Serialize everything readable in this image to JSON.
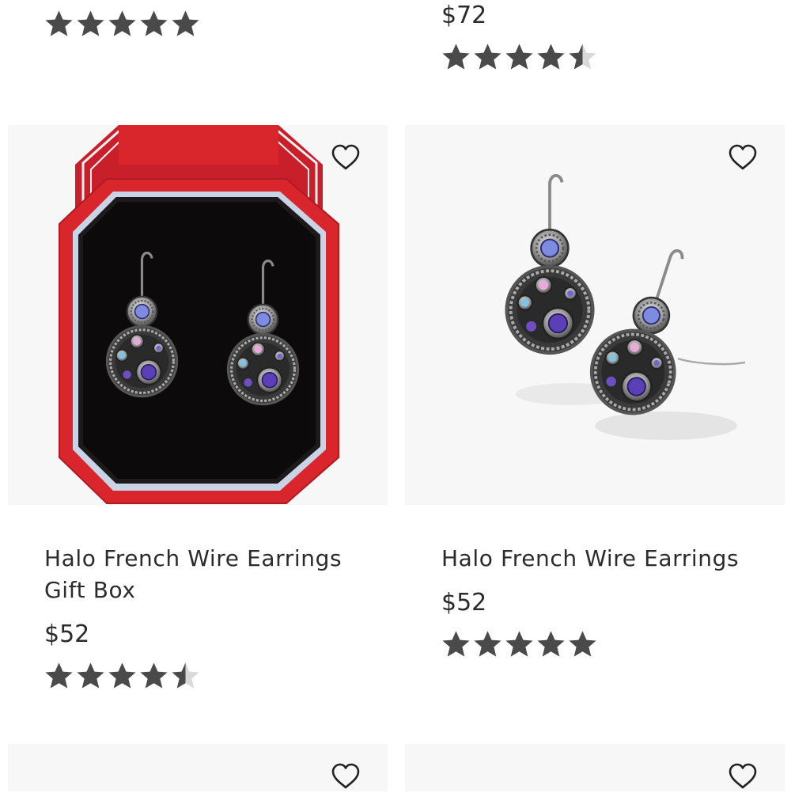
{
  "colors": {
    "star": "#4a4a4a",
    "star_empty": "#d9d9d9",
    "box_red": "#d8262c",
    "image_bg": "#f7f7f7"
  },
  "top_left": {
    "rating": 5
  },
  "top_right": {
    "price": "$72",
    "rating": 4.5
  },
  "products": [
    {
      "title_line1": "Halo French Wire Earrings",
      "title_line2": "Gift Box",
      "price": "$52",
      "rating": 4.5,
      "image": "earrings-in-red-gift-box",
      "wishlist_icon": "heart-outline-icon"
    },
    {
      "title_line1": "Halo French Wire Earrings",
      "price": "$52",
      "rating": 5,
      "image": "earrings-on-white",
      "wishlist_icon": "heart-outline-icon"
    }
  ],
  "bottom_cards": {
    "wishlist_icon": "heart-outline-icon"
  }
}
